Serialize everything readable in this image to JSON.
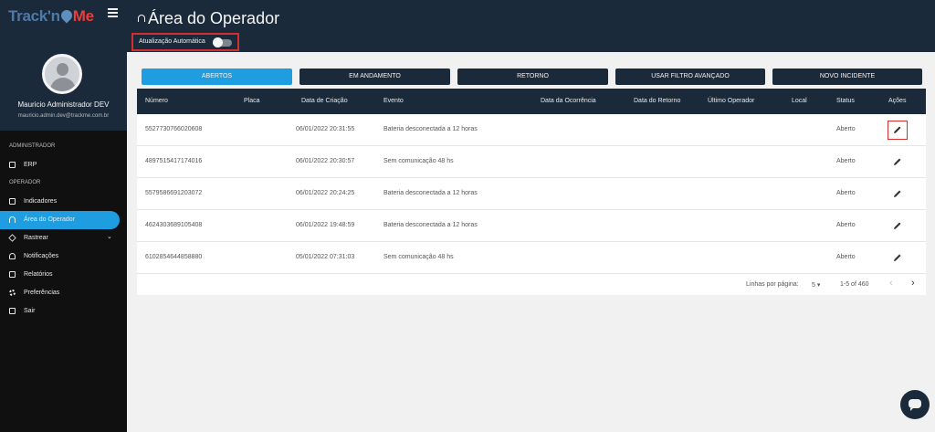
{
  "app": {
    "logo_part1": "Track'n",
    "logo_part2": "Me",
    "logo_tm": "®"
  },
  "user": {
    "name": "Mauricio Administrador DEV",
    "email": "mauricio.admin.dev@trackme.com.br"
  },
  "sidebar": {
    "sections": [
      {
        "title": "ADMINISTRADOR"
      },
      {
        "title": "OPERADOR"
      }
    ],
    "items": [
      {
        "label": "ERP",
        "icon": "bank-icon"
      },
      {
        "label": "Indicadores",
        "icon": "chart-icon"
      },
      {
        "label": "Área do Operador",
        "icon": "headset-icon",
        "active": true
      },
      {
        "label": "Rastrear",
        "icon": "diamond-icon",
        "chevron": "⌄"
      },
      {
        "label": "Notificações",
        "icon": "bell-icon"
      },
      {
        "label": "Relatórios",
        "icon": "report-icon"
      },
      {
        "label": "Preferências",
        "icon": "gear-icon"
      },
      {
        "label": "Sair",
        "icon": "logout-icon"
      }
    ]
  },
  "header": {
    "title": "Área do Operador",
    "auto_update_label": "Atualização Automática",
    "auto_update_on": false
  },
  "tabs": [
    {
      "label": "ABERTOS",
      "active": true
    },
    {
      "label": "EM ANDAMENTO"
    },
    {
      "label": "RETORNO"
    },
    {
      "label": "USAR FILTRO AVANÇADO"
    },
    {
      "label": "NOVO INCIDENTE"
    }
  ],
  "table": {
    "columns": [
      "Número",
      "Placa",
      "Data de Criação",
      "Evento",
      "Data da Ocorrência",
      "Data do Retorno",
      "Último Operador",
      "Local",
      "Status",
      "Ações"
    ],
    "rows": [
      {
        "numero": "5527730766020608",
        "placa": "",
        "criacao": "06/01/2022 20:31:55",
        "evento": "Bateria desconectada a 12 horas",
        "status": "Aberto"
      },
      {
        "numero": "4897515417174016",
        "placa": "",
        "criacao": "06/01/2022 20:30:57",
        "evento": "Sem comunicação 48 hs",
        "status": "Aberto"
      },
      {
        "numero": "5579586691203072",
        "placa": "",
        "criacao": "06/01/2022 20:24:25",
        "evento": "Bateria desconectada a 12 horas",
        "status": "Aberto"
      },
      {
        "numero": "4624303689105408",
        "placa": "",
        "criacao": "06/01/2022 19:48:59",
        "evento": "Bateria desconectada a 12 horas",
        "status": "Aberto"
      },
      {
        "numero": "6102854644858880",
        "placa": "",
        "criacao": "05/01/2022 07:31:03",
        "evento": "Sem comunicação 48 hs",
        "status": "Aberto"
      }
    ]
  },
  "pagination": {
    "rows_per_page_label": "Linhas por página:",
    "rows_per_page": "5",
    "range": "1-5 of 460",
    "prev": "‹",
    "next": "›"
  },
  "colors": {
    "navy": "#1a2a3b",
    "accent": "#1e9ee0",
    "highlight": "#d32f2f"
  }
}
